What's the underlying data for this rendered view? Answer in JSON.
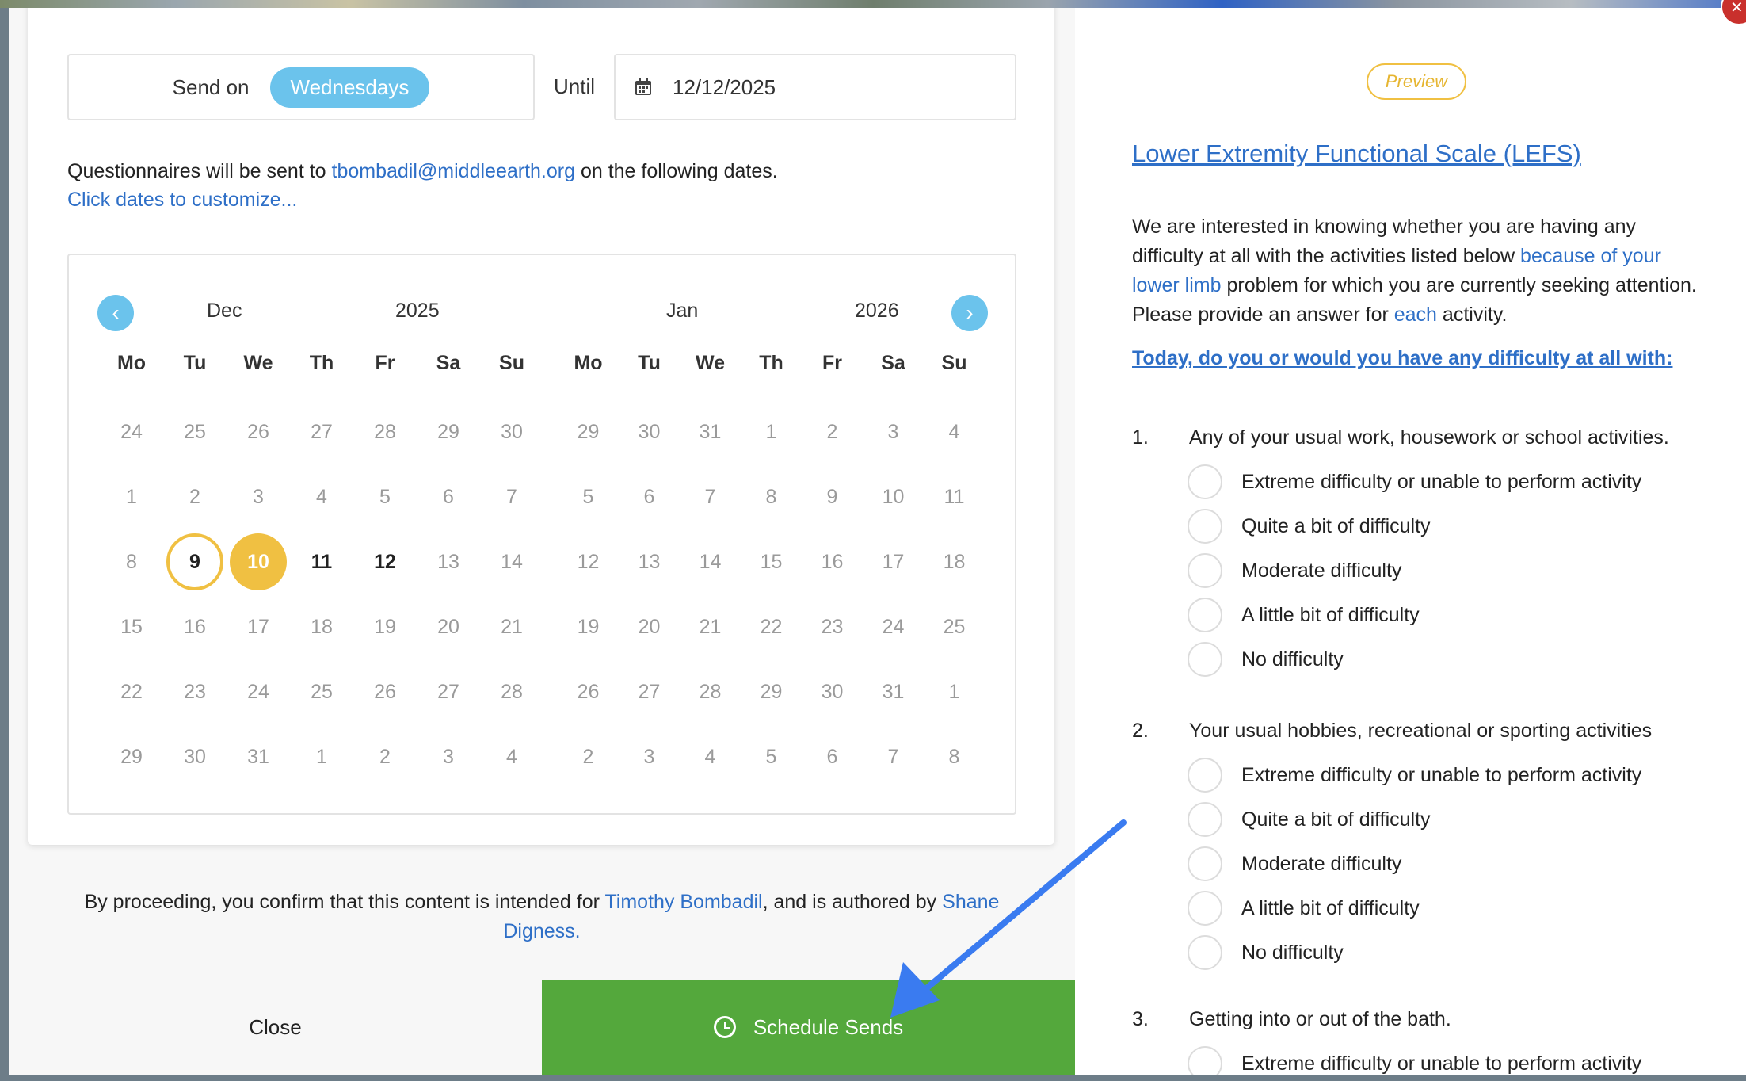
{
  "send": {
    "send_on_label": "Send on",
    "day_value": "Wednesdays",
    "until_label": "Until",
    "until_date": "12/12/2025"
  },
  "info": {
    "prefix": "Questionnaires will be sent to ",
    "email": "tbombadil@middleearth.org",
    "suffix": " on the following dates.",
    "customize": "Click dates to customize..."
  },
  "calendar": {
    "left": {
      "month": "Dec",
      "year": "2025",
      "days": [
        [
          "24",
          "muted"
        ],
        [
          "25",
          "muted"
        ],
        [
          "26",
          "muted"
        ],
        [
          "27",
          "muted"
        ],
        [
          "28",
          "muted"
        ],
        [
          "29",
          "muted"
        ],
        [
          "30",
          "muted"
        ],
        [
          "1",
          "muted"
        ],
        [
          "2",
          "muted"
        ],
        [
          "3",
          "muted"
        ],
        [
          "4",
          "muted"
        ],
        [
          "5",
          "muted"
        ],
        [
          "6",
          "muted"
        ],
        [
          "7",
          "muted"
        ],
        [
          "8",
          "muted"
        ],
        [
          "9",
          "today"
        ],
        [
          "10",
          "selected"
        ],
        [
          "11",
          "dark"
        ],
        [
          "12",
          "dark"
        ],
        [
          "13",
          "muted"
        ],
        [
          "14",
          "muted"
        ],
        [
          "15",
          "muted"
        ],
        [
          "16",
          "muted"
        ],
        [
          "17",
          "muted"
        ],
        [
          "18",
          "muted"
        ],
        [
          "19",
          "muted"
        ],
        [
          "20",
          "muted"
        ],
        [
          "21",
          "muted"
        ],
        [
          "22",
          "muted"
        ],
        [
          "23",
          "muted"
        ],
        [
          "24",
          "muted"
        ],
        [
          "25",
          "muted"
        ],
        [
          "26",
          "muted"
        ],
        [
          "27",
          "muted"
        ],
        [
          "28",
          "muted"
        ],
        [
          "29",
          "muted"
        ],
        [
          "30",
          "muted"
        ],
        [
          "31",
          "muted"
        ],
        [
          "1",
          "muted"
        ],
        [
          "2",
          "muted"
        ],
        [
          "3",
          "muted"
        ],
        [
          "4",
          "muted"
        ]
      ]
    },
    "right": {
      "month": "Jan",
      "year": "2026",
      "days": [
        [
          "29",
          "muted"
        ],
        [
          "30",
          "muted"
        ],
        [
          "31",
          "muted"
        ],
        [
          "1",
          "muted"
        ],
        [
          "2",
          "muted"
        ],
        [
          "3",
          "muted"
        ],
        [
          "4",
          "muted"
        ],
        [
          "5",
          "muted"
        ],
        [
          "6",
          "muted"
        ],
        [
          "7",
          "muted"
        ],
        [
          "8",
          "muted"
        ],
        [
          "9",
          "muted"
        ],
        [
          "10",
          "muted"
        ],
        [
          "11",
          "muted"
        ],
        [
          "12",
          "muted"
        ],
        [
          "13",
          "muted"
        ],
        [
          "14",
          "muted"
        ],
        [
          "15",
          "muted"
        ],
        [
          "16",
          "muted"
        ],
        [
          "17",
          "muted"
        ],
        [
          "18",
          "muted"
        ],
        [
          "19",
          "muted"
        ],
        [
          "20",
          "muted"
        ],
        [
          "21",
          "muted"
        ],
        [
          "22",
          "muted"
        ],
        [
          "23",
          "muted"
        ],
        [
          "24",
          "muted"
        ],
        [
          "25",
          "muted"
        ],
        [
          "26",
          "muted"
        ],
        [
          "27",
          "muted"
        ],
        [
          "28",
          "muted"
        ],
        [
          "29",
          "muted"
        ],
        [
          "30",
          "muted"
        ],
        [
          "31",
          "muted"
        ],
        [
          "1",
          "muted"
        ],
        [
          "2",
          "muted"
        ],
        [
          "3",
          "muted"
        ],
        [
          "4",
          "muted"
        ],
        [
          "5",
          "muted"
        ],
        [
          "6",
          "muted"
        ],
        [
          "7",
          "muted"
        ],
        [
          "8",
          "muted"
        ]
      ]
    },
    "weekdays": [
      "Mo",
      "Tu",
      "We",
      "Th",
      "Fr",
      "Sa",
      "Su"
    ],
    "prev_glyph": "‹",
    "next_glyph": "›"
  },
  "consent": {
    "prefix": "By proceeding, you confirm that this content is intended for ",
    "patient": "Timothy Bombadil",
    "middle": ", and is authored by ",
    "author": "Shane Digness."
  },
  "actions": {
    "close_label": "Close",
    "schedule_label": "Schedule Sends"
  },
  "preview": {
    "badge": "Preview",
    "title": "Lower Extremity Functional Scale (LEFS)",
    "intro_1": "We are interested in knowing whether you are having any difficulty at all with the activities listed below ",
    "intro_link": "because of your lower limb",
    "intro_2": " problem for which you are currently seeking attention. Please provide an answer for ",
    "intro_each": "each",
    "intro_3": " activity.",
    "today_question": "Today, do you or would you have any difficulty at all with:",
    "questions": [
      {
        "num": "1.",
        "text": "Any of your usual work, housework or school activities.",
        "options": [
          "Extreme difficulty or unable to perform activity",
          "Quite a bit of difficulty",
          "Moderate difficulty",
          "A little bit of difficulty",
          "No difficulty"
        ]
      },
      {
        "num": "2.",
        "text": "Your usual hobbies, recreational or sporting activities",
        "options": [
          "Extreme difficulty or unable to perform activity",
          "Quite a bit of difficulty",
          "Moderate difficulty",
          "A little bit of difficulty",
          "No difficulty"
        ]
      },
      {
        "num": "3.",
        "text": "Getting into or out of the bath.",
        "options": [
          "Extreme difficulty or unable to perform activity"
        ]
      }
    ]
  },
  "colors": {
    "accent_blue": "#6bc3ec",
    "link_blue": "#2e6fc7",
    "highlight_yellow": "#f0c042",
    "schedule_green": "#54a83c",
    "annotation_arrow": "#3a7bf0"
  },
  "close_glyph": "✕"
}
